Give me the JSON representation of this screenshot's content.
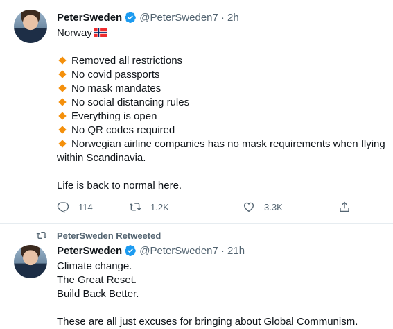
{
  "tweet1": {
    "name": "PeterSweden",
    "handle": "@PeterSweden7",
    "time": "· 2h",
    "first_line": "Norway",
    "flag": "Norwegian flag",
    "bullets": [
      "Removed all restrictions",
      "No covid passports",
      "No mask mandates",
      "No social distancing rules",
      "Everything is open",
      "No QR codes required",
      "Norwegian airline companies has no mask requirements when flying"
    ],
    "bullet_continuation": "within Scandinavia.",
    "closing": "Life is back to normal here.",
    "actions": {
      "replies": "114",
      "retweets": "1.2K",
      "likes": "3.3K"
    }
  },
  "retweet_label": "PeterSweden Retweeted",
  "tweet2": {
    "name": "PeterSweden",
    "handle": "@PeterSweden7",
    "time": "· 21h",
    "lines": [
      "Climate change.",
      "The Great Reset.",
      "Build Back Better."
    ],
    "closing": "These are all just excuses for bringing about Global Communism."
  },
  "colors": {
    "verified": "#1d9bf0",
    "muted": "#536471",
    "bullet_diamond": "#f4900c"
  },
  "icons": [
    "verified-badge-icon",
    "reply-icon",
    "retweet-icon",
    "like-icon",
    "share-icon"
  ]
}
